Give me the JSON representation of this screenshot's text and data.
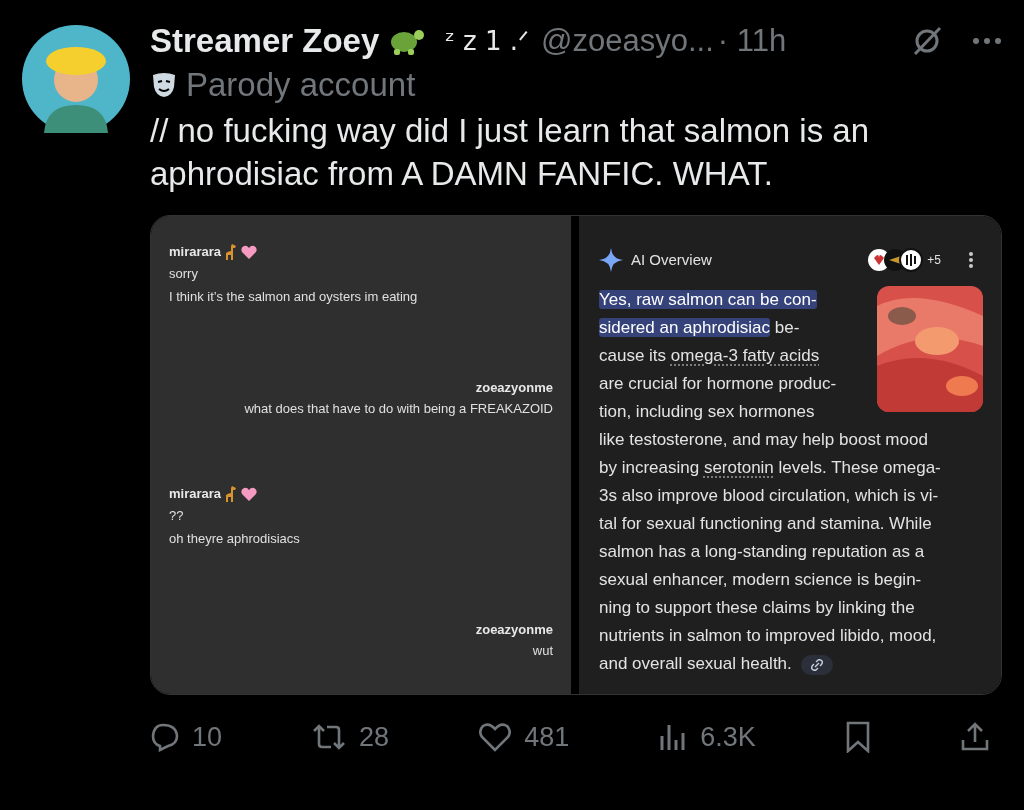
{
  "author": {
    "display_name": "Streamer Zoey",
    "name_decoration": "ᶻ z 1 .ᐟ",
    "handle": "@zoeasyo...",
    "time": "· 11h",
    "label": "Parody account"
  },
  "tweet_text": "// no fucking way did I just learn that salmon is an aphrodisiac from A DAMN FANFIC. WHAT.",
  "chat": [
    {
      "sender": "mirarara",
      "outgoing": false,
      "lines": [
        "sorry",
        "I think it’s the salmon and oysters im eating"
      ]
    },
    {
      "sender": "zoeazyonme",
      "outgoing": true,
      "lines": [
        "what does that have to do with being a FREAKAZOID"
      ]
    },
    {
      "sender": "mirarara",
      "outgoing": false,
      "lines": [
        "??",
        "oh theyre aphrodisiacs"
      ]
    },
    {
      "sender": "zoeazyonme",
      "outgoing": true,
      "lines": [
        "wut"
      ]
    }
  ],
  "ai_overview": {
    "title": "AI Overview",
    "source_count": "+5",
    "lines": [
      [
        {
          "text": "Yes, raw salmon can be con-",
          "kind": "highlight"
        }
      ],
      [
        {
          "text": "sidered an aphrodisiac",
          "kind": "highlight"
        },
        {
          "text": " be-",
          "kind": "plain"
        }
      ],
      [
        {
          "text": "cause its ",
          "kind": "plain"
        },
        {
          "text": "omega-3 fatty acids",
          "kind": "term"
        }
      ],
      [
        {
          "text": "are crucial for hormone produc-",
          "kind": "plain"
        }
      ],
      [
        {
          "text": "tion, including sex hormones",
          "kind": "plain"
        }
      ],
      [
        {
          "text": "like testosterone, and may help boost mood",
          "kind": "plain"
        }
      ],
      [
        {
          "text": "by increasing ",
          "kind": "plain"
        },
        {
          "text": "serotonin",
          "kind": "term"
        },
        {
          "text": " levels. These omega-",
          "kind": "plain"
        }
      ],
      [
        {
          "text": "3s also improve blood circulation, which is vi-",
          "kind": "plain"
        }
      ],
      [
        {
          "text": "tal for sexual functioning and stamina. While",
          "kind": "plain"
        }
      ],
      [
        {
          "text": "salmon has a long-standing reputation as a",
          "kind": "plain"
        }
      ],
      [
        {
          "text": "sexual enhancer, modern science is begin-",
          "kind": "plain"
        }
      ],
      [
        {
          "text": "ning to support these claims by linking the",
          "kind": "plain"
        }
      ],
      [
        {
          "text": "nutrients in salmon to improved libido, mood,",
          "kind": "plain"
        }
      ],
      [
        {
          "text": "and overall sexual health.",
          "kind": "plain"
        }
      ]
    ]
  },
  "actions": [
    {
      "kind": "reply",
      "count": "10"
    },
    {
      "kind": "repost",
      "count": "28"
    },
    {
      "kind": "like",
      "count": "481"
    },
    {
      "kind": "views",
      "count": "6.3K"
    },
    {
      "kind": "bookmark"
    },
    {
      "kind": "share"
    }
  ]
}
